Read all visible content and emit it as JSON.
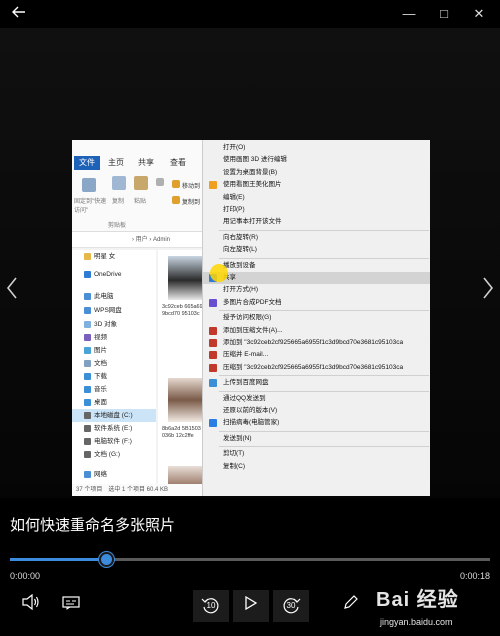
{
  "titlebar": {
    "back_icon": "back-arrow-icon",
    "minimize_glyph": "—",
    "maximize_glyph": "□",
    "close_glyph": "✕"
  },
  "viewer": {
    "prev_glyph": "‹",
    "next_glyph": "›"
  },
  "explorer": {
    "tabs": [
      "文件",
      "主页",
      "共享",
      "查看"
    ],
    "ribbon_buttons": [
      "固定到\"快速访问\"",
      "复制",
      "粘贴",
      "移动到",
      "复制到"
    ],
    "ribbon_group": "剪贴板",
    "address": "› 用户 › Admin",
    "tree": [
      {
        "label": "明星 女",
        "icon_color": "#e6b84a"
      },
      {
        "label": "OneDrive",
        "icon_color": "#2f7bd6"
      },
      {
        "label": "此电脑",
        "icon_color": "#4a8fd6"
      },
      {
        "label": "WPS网盘",
        "icon_color": "#4a8fd6"
      },
      {
        "label": "3D 对象",
        "icon_color": "#7fb0e0"
      },
      {
        "label": "视频",
        "icon_color": "#7a5fbf"
      },
      {
        "label": "图片",
        "icon_color": "#4aa3d6"
      },
      {
        "label": "文档",
        "icon_color": "#7fa0c0"
      },
      {
        "label": "下载",
        "icon_color": "#3b8fd6"
      },
      {
        "label": "音乐",
        "icon_color": "#3b8fd6"
      },
      {
        "label": "桌面",
        "icon_color": "#3b8fd6"
      },
      {
        "label": "本地磁盘 (C:)",
        "icon_color": "#666666"
      },
      {
        "label": "软件系统 (E:)",
        "icon_color": "#666666"
      },
      {
        "label": "电脑软件 (F:)",
        "icon_color": "#666666"
      },
      {
        "label": "文档 (G:)",
        "icon_color": "#666666"
      },
      {
        "label": "网络",
        "icon_color": "#4a8fd6"
      }
    ],
    "files": [
      {
        "caption": "3c92ceb 665a695 9bcd70 95103c"
      },
      {
        "caption": "8b6a2d 5B1503 e1036b 12c2ffe"
      }
    ],
    "status": "37 个项目　选中 1 个项目 60.4 KB"
  },
  "context_menu": [
    {
      "label": "打开(O)",
      "icon": "",
      "icon_color": ""
    },
    {
      "label": "使用画图 3D 进行编辑",
      "icon": "",
      "icon_color": ""
    },
    {
      "label": "设置为桌面背景(B)",
      "icon": "",
      "icon_color": ""
    },
    {
      "label": "使用看图王美化图片",
      "icon": "image-icon",
      "icon_color": "#f0a020"
    },
    {
      "label": "编辑(E)",
      "icon": "",
      "icon_color": ""
    },
    {
      "label": "打印(P)",
      "icon": "",
      "icon_color": ""
    },
    {
      "label": "用记事本打开该文件",
      "icon": "",
      "icon_color": ""
    },
    {
      "label": "SEP",
      "icon": "",
      "icon_color": ""
    },
    {
      "label": "向右旋转(R)",
      "icon": "",
      "icon_color": ""
    },
    {
      "label": "向左旋转(L)",
      "icon": "",
      "icon_color": ""
    },
    {
      "label": "SEP",
      "icon": "",
      "icon_color": ""
    },
    {
      "label": "播放到设备",
      "icon": "",
      "icon_color": ""
    },
    {
      "label": "共享",
      "icon": "share-icon",
      "icon_color": "#2f7bd6"
    },
    {
      "label": "打开方式(H)",
      "icon": "",
      "icon_color": ""
    },
    {
      "label": "多图片合成PDF文档",
      "icon": "pdf-icon",
      "icon_color": "#6a4fd0"
    },
    {
      "label": "SEP",
      "icon": "",
      "icon_color": ""
    },
    {
      "label": "授予访问权限(G)",
      "icon": "",
      "icon_color": ""
    },
    {
      "label": "添加到压缩文件(A)...",
      "icon": "archive-icon",
      "icon_color": "#c0392b"
    },
    {
      "label": "添加到 \"3c92ceb2cf925665a6955f1c3d9bcd70e3681c95103ca",
      "icon": "archive-icon",
      "icon_color": "#c0392b"
    },
    {
      "label": "压缩并 E-mail...",
      "icon": "archive-icon",
      "icon_color": "#c0392b"
    },
    {
      "label": "压缩到 \"3c92ceb2cf925665a6955f1c3d9bcd70e3681c95103ca",
      "icon": "archive-icon",
      "icon_color": "#c0392b"
    },
    {
      "label": "SEP",
      "icon": "",
      "icon_color": ""
    },
    {
      "label": "上传到百度网盘",
      "icon": "cloud-icon",
      "icon_color": "#3b8fd6"
    },
    {
      "label": "SEP",
      "icon": "",
      "icon_color": ""
    },
    {
      "label": "通过QQ发送到",
      "icon": "",
      "icon_color": ""
    },
    {
      "label": "还原以前的版本(V)",
      "icon": "",
      "icon_color": ""
    },
    {
      "label": "扫描病毒(电脑管家)",
      "icon": "shield-icon",
      "icon_color": "#2a7de1"
    },
    {
      "label": "SEP",
      "icon": "",
      "icon_color": ""
    },
    {
      "label": "发送到(N)",
      "icon": "",
      "icon_color": ""
    },
    {
      "label": "SEP",
      "icon": "",
      "icon_color": ""
    },
    {
      "label": "剪切(T)",
      "icon": "",
      "icon_color": ""
    },
    {
      "label": "复制(C)",
      "icon": "",
      "icon_color": ""
    }
  ],
  "video": {
    "title": "如何快速重命名多张照片",
    "current_time": "0:00:00",
    "duration": "0:00:18",
    "progress": 0.2,
    "accent": "#3d8bdc"
  },
  "controls": {
    "volume_icon": "volume-icon",
    "subtitles_icon": "subtitles-icon",
    "rewind_label": "10",
    "play_icon": "play-icon",
    "forward_label": "30",
    "edit_icon": "pen-icon"
  },
  "watermark": {
    "logo": "Bai 经验",
    "url": "jingyan.baidu.com"
  }
}
